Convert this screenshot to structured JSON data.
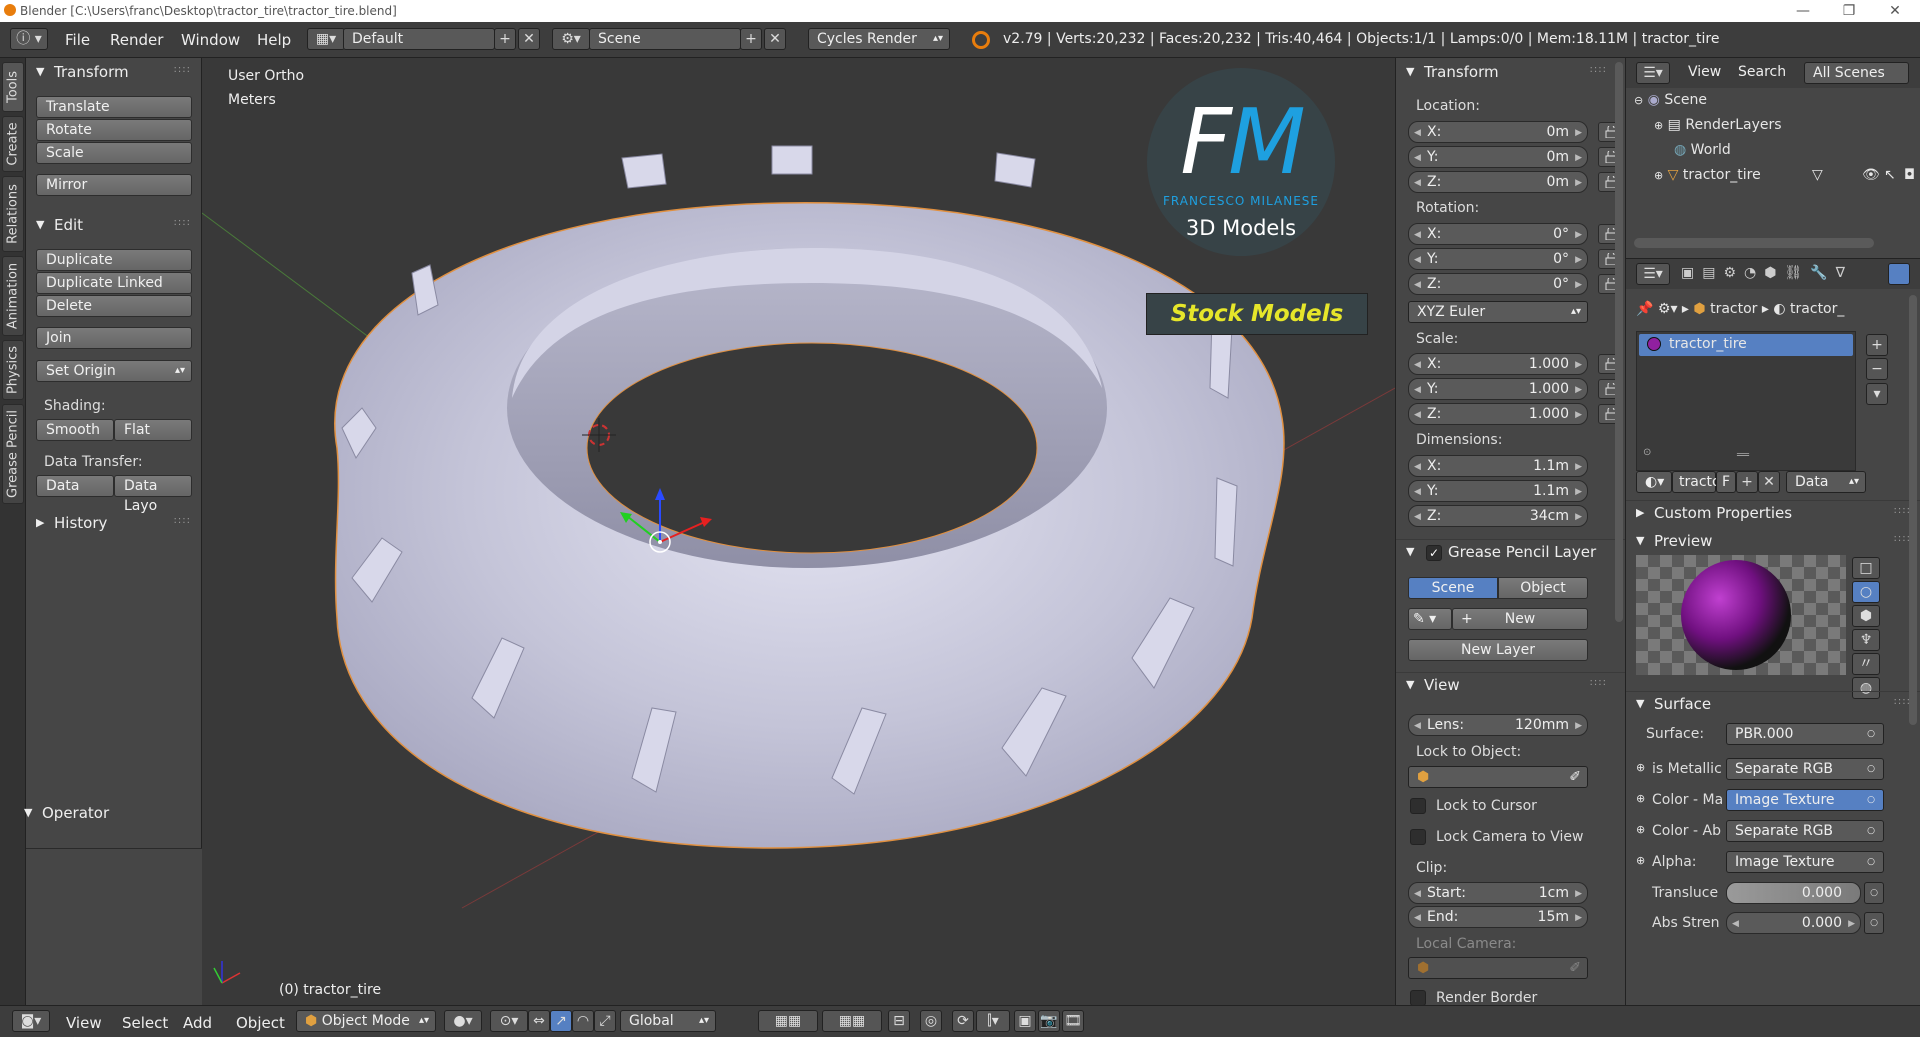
{
  "window": {
    "title": "Blender [C:\\Users\\franc\\Desktop\\tractor_tire\\tractor_tire.blend]",
    "minimize": "—",
    "maximize": "❐",
    "close": "✕"
  },
  "menubar": {
    "menus": [
      "File",
      "Render",
      "Window",
      "Help"
    ],
    "layout": "Default",
    "scene": "Scene",
    "engine": "Cycles Render",
    "stats": "v2.79 | Verts:20,232 | Faces:20,232 | Tris:40,464 | Objects:1/1 | Lamps:0/0 | Mem:18.11M | tractor_tire"
  },
  "vtabs": [
    "Tools",
    "Create",
    "Relations",
    "Animation",
    "Physics",
    "Grease Pencil"
  ],
  "toolshelf": {
    "transform": {
      "header": "Transform",
      "buttons": [
        "Translate",
        "Rotate",
        "Scale",
        "Mirror"
      ]
    },
    "edit": {
      "header": "Edit",
      "buttons": [
        "Duplicate",
        "Duplicate Linked",
        "Delete",
        "Join"
      ],
      "set_origin": "Set Origin",
      "shading_label": "Shading:",
      "smooth": "Smooth",
      "flat": "Flat",
      "data_transfer_label": "Data Transfer:",
      "data": "Data",
      "data_layout": "Data Layo"
    },
    "history": "History",
    "operator": "Operator"
  },
  "viewport": {
    "view_name": "User Ortho",
    "units": "Meters",
    "object_label": "(0) tractor_tire",
    "watermark": {
      "letters": "FM",
      "author": "FRANCESCO MILANESE",
      "line2": "3D Models",
      "banner": "Stock Models"
    }
  },
  "npanel": {
    "transform_header": "Transform",
    "location_label": "Location:",
    "location": [
      {
        "k": "X:",
        "v": "0m"
      },
      {
        "k": "Y:",
        "v": "0m"
      },
      {
        "k": "Z:",
        "v": "0m"
      }
    ],
    "rotation_label": "Rotation:",
    "rotation": [
      {
        "k": "X:",
        "v": "0°"
      },
      {
        "k": "Y:",
        "v": "0°"
      },
      {
        "k": "Z:",
        "v": "0°"
      }
    ],
    "rotation_mode": "XYZ Euler",
    "scale_label": "Scale:",
    "scale": [
      {
        "k": "X:",
        "v": "1.000"
      },
      {
        "k": "Y:",
        "v": "1.000"
      },
      {
        "k": "Z:",
        "v": "1.000"
      }
    ],
    "dimensions_label": "Dimensions:",
    "dimensions": [
      {
        "k": "X:",
        "v": "1.1m"
      },
      {
        "k": "Y:",
        "v": "1.1m"
      },
      {
        "k": "Z:",
        "v": "34cm"
      }
    ],
    "grease_header": "Grease Pencil Layer",
    "gp_scene": "Scene",
    "gp_object": "Object",
    "gp_new": "New",
    "gp_new_layer": "New Layer",
    "view_header": "View",
    "lens_label": "Lens:",
    "lens_value": "120mm",
    "lock_obj_label": "Lock to Object:",
    "lock_cursor": "Lock to Cursor",
    "lock_camera": "Lock Camera to View",
    "clip_label": "Clip:",
    "clip_start_k": "Start:",
    "clip_start_v": "1cm",
    "clip_end_k": "End:",
    "clip_end_v": "15m",
    "local_camera": "Local Camera:",
    "render_border": "Render Border"
  },
  "outliner": {
    "view": "View",
    "search": "Search",
    "filter": "All Scenes",
    "items": [
      "Scene",
      "RenderLayers",
      "World",
      "tractor_tire"
    ]
  },
  "properties": {
    "breadcrumb1": "tractor",
    "breadcrumb2": "tractor_",
    "material_slot": "tractor_tire",
    "mat_name": "tracto",
    "mat_f": "F",
    "mat_link": "Data",
    "custom_props": "Custom Properties",
    "preview": "Preview",
    "surface_header": "Surface",
    "surface_label": "Surface:",
    "surface_value": "PBR.000",
    "inputs": [
      {
        "k": "is Metallic",
        "v": "Separate RGB",
        "hl": false
      },
      {
        "k": "Color - Ma",
        "v": "Image Texture",
        "hl": true
      },
      {
        "k": "Color - Ab",
        "v": "Separate RGB",
        "hl": false
      },
      {
        "k": "Alpha:",
        "v": "Image Texture",
        "hl": false
      }
    ],
    "translucency_k": "Transluce",
    "translucency_v": "0.000",
    "abs_k": "Abs Stren",
    "abs_v": "0.000"
  },
  "bottombar": {
    "menus": [
      "View",
      "Select",
      "Add",
      "Object"
    ],
    "mode": "Object Mode",
    "orientation": "Global"
  },
  "colors": {
    "accent": "#5680c2",
    "tire": "#c9c9dc",
    "watermark_blue": "#1ea0e0",
    "banner_text": "#e6e62a"
  }
}
